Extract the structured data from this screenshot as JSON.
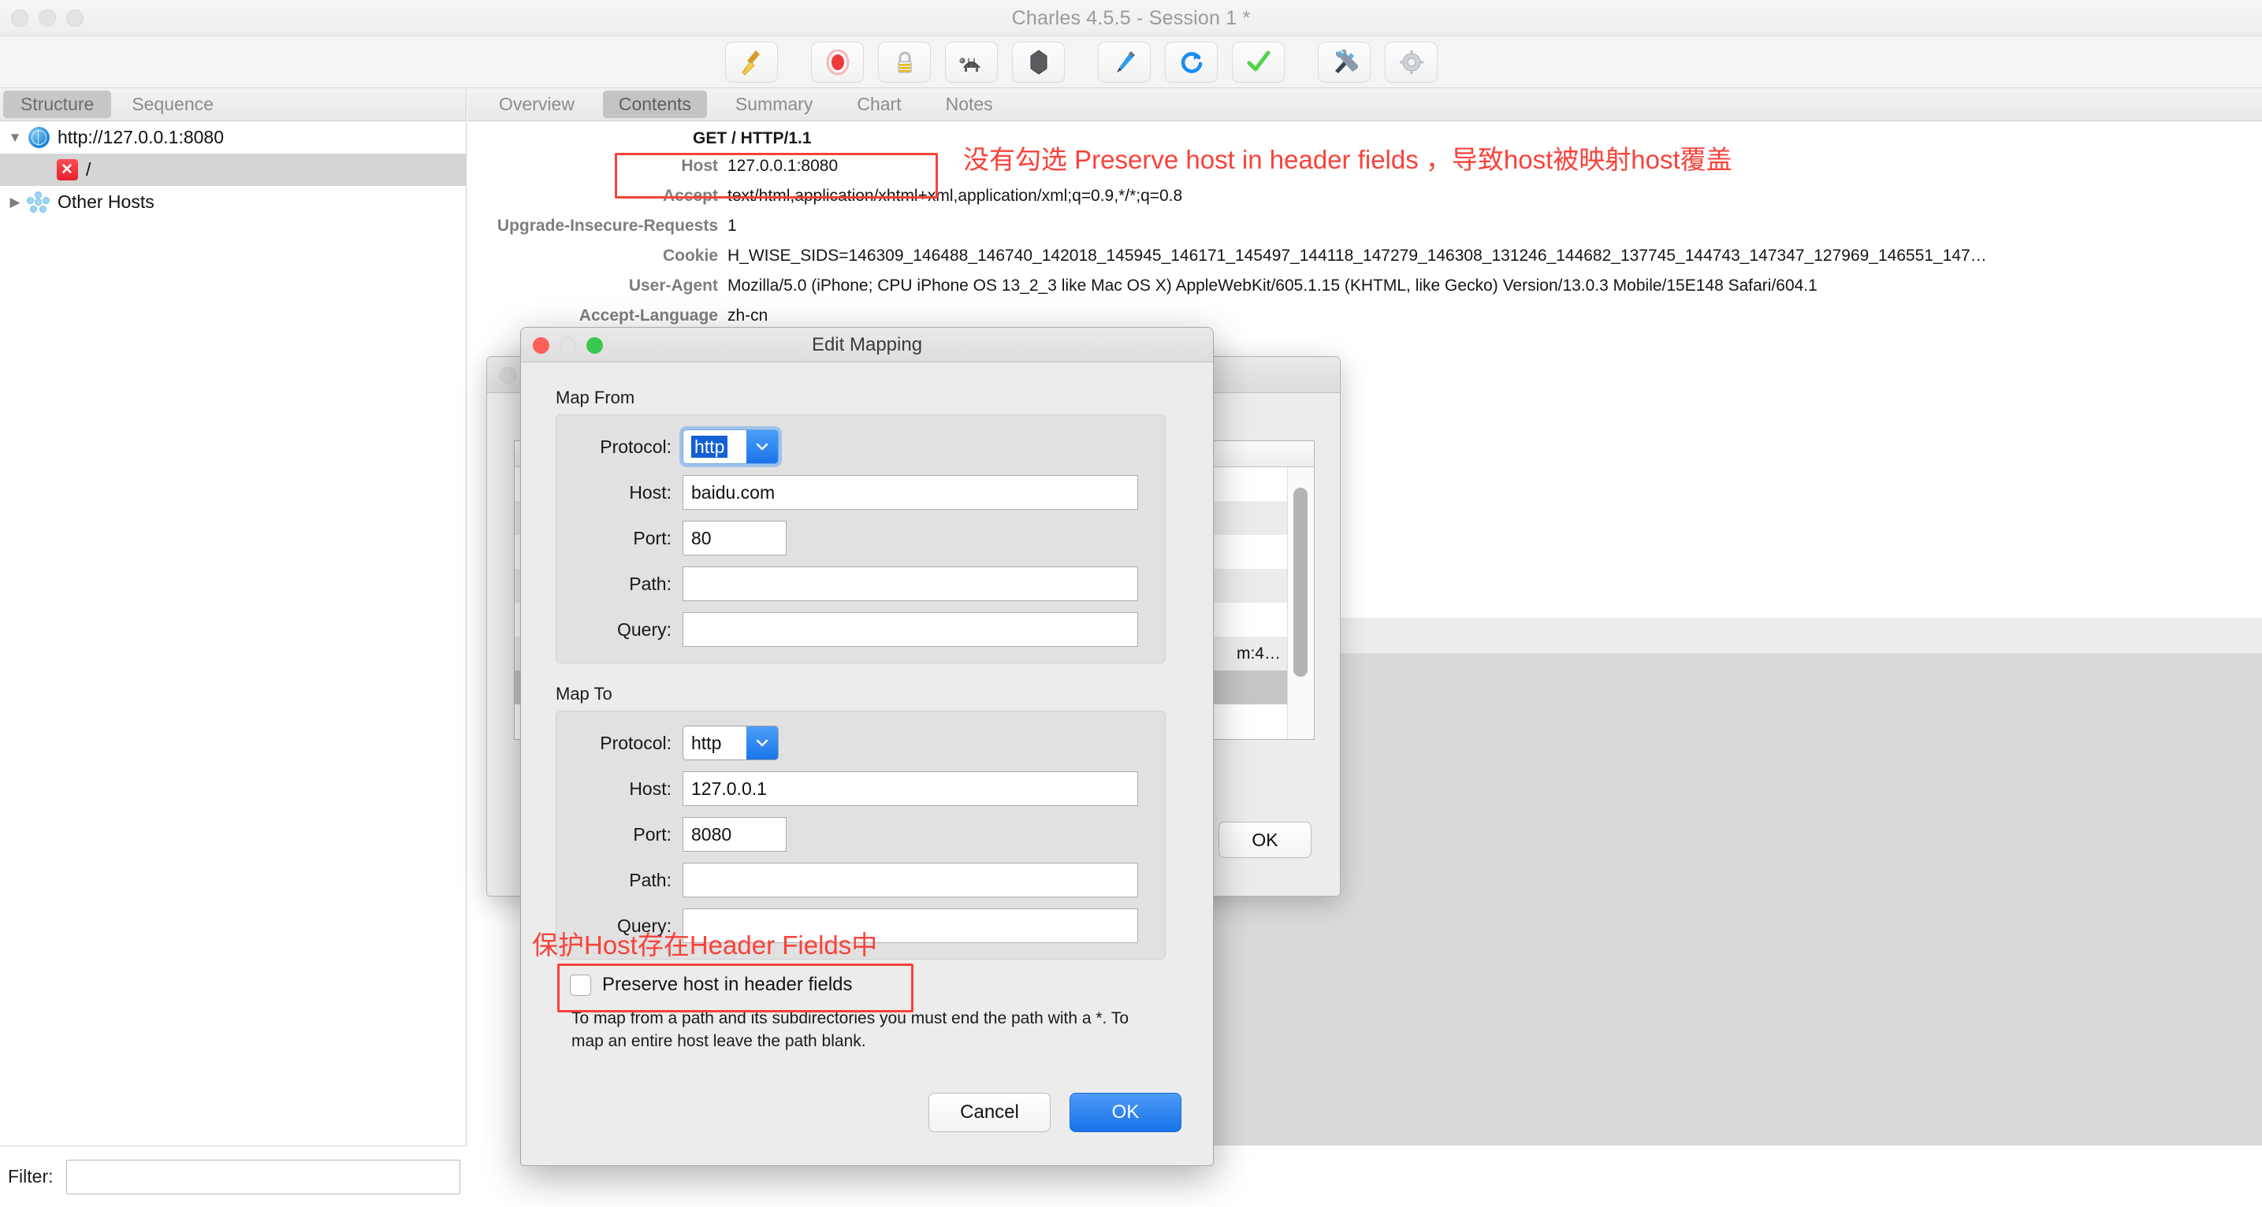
{
  "window": {
    "title": "Charles 4.5.5 - Session 1 *"
  },
  "toolbar": {
    "buttons": [
      {
        "name": "clear-session",
        "icon": "broom-icon"
      },
      {
        "name": "record",
        "icon": "record-icon"
      },
      {
        "name": "ssl-proxying",
        "icon": "lock-icon"
      },
      {
        "name": "throttle",
        "icon": "turtle-icon"
      },
      {
        "name": "breakpoints",
        "icon": "hexagon-icon"
      },
      {
        "name": "compose",
        "icon": "pen-icon"
      },
      {
        "name": "repeat",
        "icon": "refresh-icon"
      },
      {
        "name": "validate",
        "icon": "checkmark-icon"
      },
      {
        "name": "tools",
        "icon": "tools-icon"
      },
      {
        "name": "settings",
        "icon": "gear-icon"
      }
    ]
  },
  "sidebar": {
    "segments": [
      {
        "label": "Structure",
        "active": true
      },
      {
        "label": "Sequence",
        "active": false
      }
    ],
    "tree": [
      {
        "label": "http://127.0.0.1:8080",
        "icon": "globe-icon",
        "disclosure": "▼",
        "selected": false,
        "indent": false
      },
      {
        "label": "/",
        "icon": "error-icon",
        "icon_text": "✕",
        "disclosure": "",
        "selected": true,
        "indent": true
      },
      {
        "label": "Other Hosts",
        "icon": "cluster-icon",
        "disclosure": "▶",
        "selected": false,
        "indent": false
      }
    ],
    "filter": {
      "label": "Filter:",
      "value": "",
      "placeholder": ""
    }
  },
  "content": {
    "tabs": [
      {
        "label": "Overview",
        "active": false
      },
      {
        "label": "Contents",
        "active": true
      },
      {
        "label": "Summary",
        "active": false
      },
      {
        "label": "Chart",
        "active": false
      },
      {
        "label": "Notes",
        "active": false
      }
    ],
    "request_line": "GET / HTTP/1.1",
    "headers": [
      {
        "name": "Host",
        "value": "127.0.0.1:8080"
      },
      {
        "name": "Accept",
        "value": "text/html,application/xhtml+xml,application/xml;q=0.9,*/*;q=0.8"
      },
      {
        "name": "Upgrade-Insecure-Requests",
        "value": "1"
      },
      {
        "name": "Cookie",
        "value": "H_WISE_SIDS=146309_146488_146740_142018_145945_146171_145497_144118_147279_146308_131246_144682_137745_144743_147347_127969_146551_147…"
      },
      {
        "name": "User-Agent",
        "value": "Mozilla/5.0 (iPhone; CPU iPhone OS 13_2_3 like Mac OS X) AppleWebKit/605.1.15 (KHTML, like Gecko) Version/13.0.3 Mobile/15E148 Safari/604.1"
      },
      {
        "name": "Accept-Language",
        "value": "zh-cn"
      }
    ]
  },
  "annotations": {
    "color": "#f9423a",
    "top_note": "没有勾选 Preserve host in header fields ，导致host被映射host覆盖",
    "middle_note": "保护Host存在Header Fields中"
  },
  "background_window": {
    "list_rows": [
      "",
      "",
      "",
      "",
      "",
      "m:4…",
      ""
    ],
    "ok_label": "OK"
  },
  "dialog": {
    "title": "Edit Mapping",
    "map_from": {
      "group_label": "Map From",
      "protocol": {
        "label": "Protocol:",
        "value": "http",
        "focused": true
      },
      "host": {
        "label": "Host:",
        "value": "baidu.com"
      },
      "port": {
        "label": "Port:",
        "value": "80"
      },
      "path": {
        "label": "Path:",
        "value": ""
      },
      "query": {
        "label": "Query:",
        "value": ""
      }
    },
    "map_to": {
      "group_label": "Map To",
      "protocol": {
        "label": "Protocol:",
        "value": "http",
        "focused": false
      },
      "host": {
        "label": "Host:",
        "value": "127.0.0.1"
      },
      "port": {
        "label": "Port:",
        "value": "8080"
      },
      "path": {
        "label": "Path:",
        "value": ""
      },
      "query": {
        "label": "Query:",
        "value": ""
      }
    },
    "preserve_checkbox": {
      "label": "Preserve host in header fields",
      "checked": false
    },
    "help_text": "To map from a path and its subdirectories you must end the path with a *. To map an entire host leave the path blank.",
    "cancel_label": "Cancel",
    "ok_label": "OK"
  }
}
